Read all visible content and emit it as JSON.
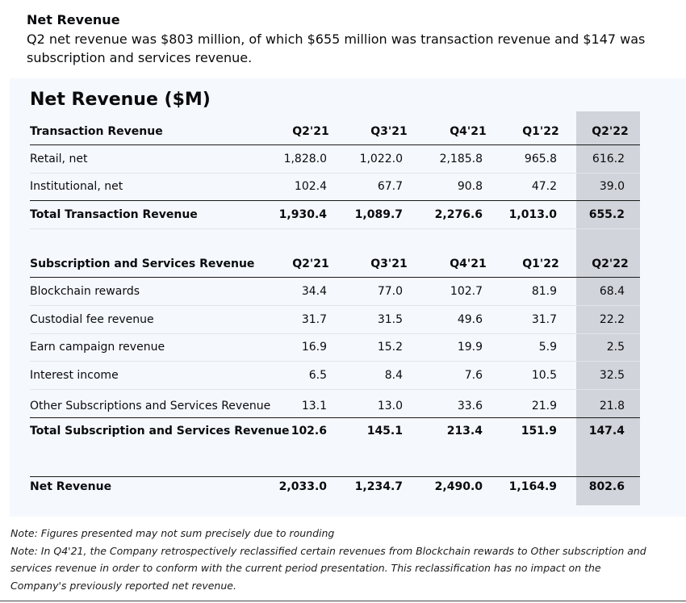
{
  "intro": {
    "title": "Net Revenue",
    "text": "Q2 net revenue was $803 million, of which $655 million was transaction revenue and $147 was subscription and services revenue."
  },
  "table": {
    "title": "Net Revenue ($M)",
    "highlight_color": "#d2d4db",
    "panel_color": "#f5f8fd",
    "columns": [
      "Q2'21",
      "Q3'21",
      "Q4'21",
      "Q1'22",
      "Q2'22"
    ],
    "transaction": {
      "header": "Transaction Revenue",
      "rows": [
        {
          "label": "Retail, net",
          "values": [
            "1,828.0",
            "1,022.0",
            "2,185.8",
            "965.8",
            "616.2"
          ]
        },
        {
          "label": "Institutional, net",
          "values": [
            "102.4",
            "67.7",
            "90.8",
            "47.2",
            "39.0"
          ]
        }
      ],
      "total": {
        "label": "Total Transaction Revenue",
        "values": [
          "1,930.4",
          "1,089.7",
          "2,276.6",
          "1,013.0",
          "655.2"
        ]
      }
    },
    "subscription": {
      "header": "Subscription and Services Revenue",
      "rows": [
        {
          "label": "Blockchain rewards",
          "values": [
            "34.4",
            "77.0",
            "102.7",
            "81.9",
            "68.4"
          ]
        },
        {
          "label": "Custodial fee revenue",
          "values": [
            "31.7",
            "31.5",
            "49.6",
            "31.7",
            "22.2"
          ]
        },
        {
          "label": "Earn campaign revenue",
          "values": [
            "16.9",
            "15.2",
            "19.9",
            "5.9",
            "2.5"
          ]
        },
        {
          "label": "Interest income",
          "values": [
            "6.5",
            "8.4",
            "7.6",
            "10.5",
            "32.5"
          ]
        },
        {
          "label": "Other Subscriptions and Services Revenue",
          "values": [
            "13.1",
            "13.0",
            "33.6",
            "21.9",
            "21.8"
          ]
        }
      ],
      "total": {
        "label": "Total Subscription and Services Revenue",
        "values": [
          "102.6",
          "145.1",
          "213.4",
          "151.9",
          "147.4"
        ]
      }
    },
    "net": {
      "label": "Net Revenue",
      "values": [
        "2,033.0",
        "1,234.7",
        "2,490.0",
        "1,164.9",
        "802.6"
      ]
    }
  },
  "notes": [
    "Note: Figures presented may not sum precisely due to rounding",
    "Note: In Q4'21, the Company retrospectively reclassified certain revenues from Blockchain rewards to Other subscription and services revenue in order to conform with the current period presentation. This reclassification has no impact on the Company's previously reported net revenue."
  ]
}
